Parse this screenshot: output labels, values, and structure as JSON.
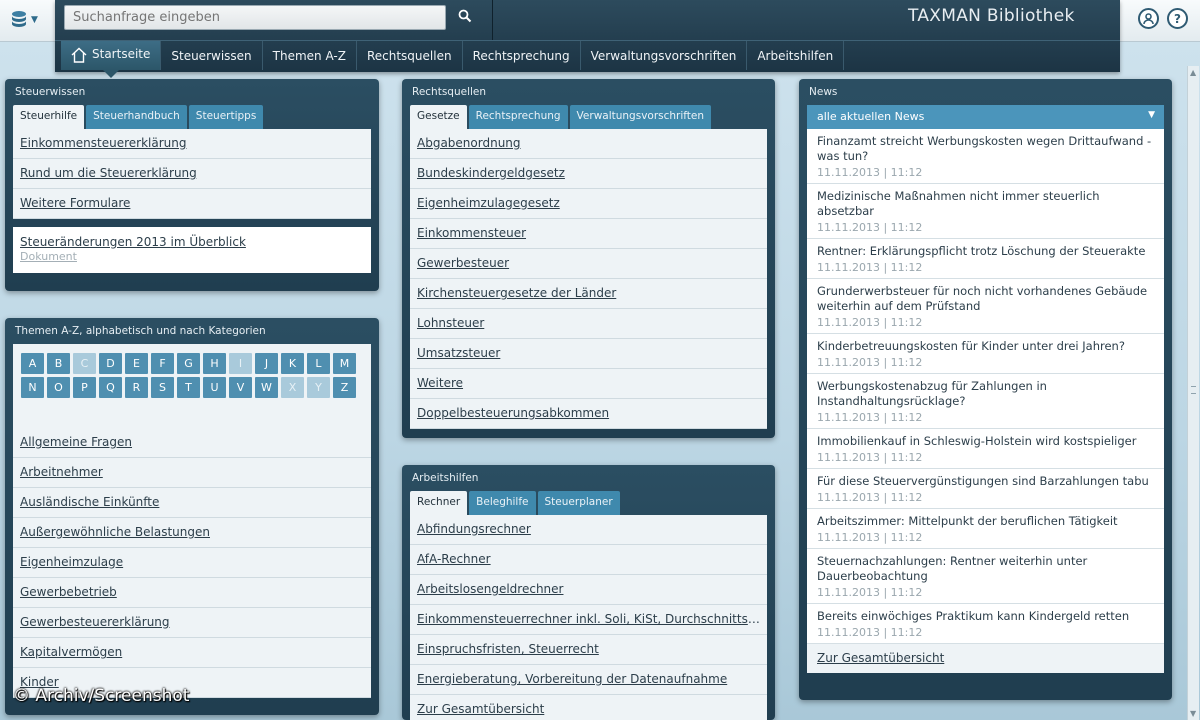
{
  "app": {
    "title": "TAXMAN Bibliothek"
  },
  "search": {
    "placeholder": "Suchanfrage eingeben"
  },
  "nav": {
    "items": [
      "Startseite",
      "Steuerwissen",
      "Themen A-Z",
      "Rechtsquellen",
      "Rechtsprechung",
      "Verwaltungsvorschriften",
      "Arbeitshilfen"
    ]
  },
  "steuerwissen": {
    "title": "Steuerwissen",
    "tabs": [
      "Steuerhilfe",
      "Steuerhandbuch",
      "Steuertipps"
    ],
    "items": [
      "Einkommensteuererklärung",
      "Rund um die Steuererklärung",
      "Weitere Formulare"
    ],
    "doc_title": "Steueränderungen 2013 im Überblick",
    "doc_type": "Dokument"
  },
  "themen": {
    "title": "Themen A-Z, alphabetisch und nach Kategorien",
    "row1": [
      "A",
      "B",
      "C",
      "D",
      "E",
      "F",
      "G",
      "H",
      "I",
      "J",
      "K",
      "L",
      "M"
    ],
    "row2": [
      "N",
      "O",
      "P",
      "Q",
      "R",
      "S",
      "T",
      "U",
      "V",
      "W",
      "X",
      "Y",
      "Z"
    ],
    "disabled": [
      "C",
      "I",
      "X",
      "Y"
    ],
    "items": [
      "Allgemeine Fragen",
      "Arbeitnehmer",
      "Ausländische Einkünfte",
      "Außergewöhnliche Belastungen",
      "Eigenheimzulage",
      "Gewerbebetrieb",
      "Gewerbesteuererklärung",
      "Kapitalvermögen",
      "Kinder"
    ]
  },
  "rechtsquellen": {
    "title": "Rechtsquellen",
    "tabs": [
      "Gesetze",
      "Rechtsprechung",
      "Verwaltungsvorschriften"
    ],
    "items": [
      "Abgabenordnung",
      "Bundeskindergeldgesetz",
      "Eigenheimzulagegesetz",
      "Einkommensteuer",
      "Gewerbesteuer",
      "Kirchensteuergesetze der Länder",
      "Lohnsteuer",
      "Umsatzsteuer",
      "Weitere",
      "Doppelbesteuerungsabkommen"
    ]
  },
  "arbeitshilfen": {
    "title": "Arbeitshilfen",
    "tabs": [
      "Rechner",
      "Beleghilfe",
      "Steuerplaner"
    ],
    "items": [
      "Abfindungsrechner",
      "AfA-Rechner",
      "Arbeitslosengeldrechner",
      "Einkommensteuerrechner inkl. Soli, KiSt, Durchschnitts- u. Grenzsteuersatz",
      "Einspruchsfristen, Steuerrecht",
      "Energieberatung, Vorbereitung der Datenaufnahme",
      "Zur Gesamtübersicht"
    ]
  },
  "news": {
    "title": "News",
    "dropdown": "alle aktuellen News",
    "items": [
      {
        "title": "Finanzamt streicht Werbungskosten wegen Drittaufwand - was tun?",
        "date": "11.11.2013 | 11:12"
      },
      {
        "title": "Medizinische Maßnahmen nicht immer steuerlich absetzbar",
        "date": "11.11.2013 | 11:12"
      },
      {
        "title": "Rentner: Erklärungspflicht trotz Löschung der Steuerakte",
        "date": "11.11.2013 | 11:12"
      },
      {
        "title": "Grunderwerbsteuer für noch nicht vorhandenes Gebäude weiterhin auf dem Prüfstand",
        "date": "11.11.2013 | 11:12"
      },
      {
        "title": "Kinderbetreuungskosten für Kinder unter drei Jahren?",
        "date": "11.11.2013 | 11:12"
      },
      {
        "title": "Werbungskostenabzug für Zahlungen in Instandhaltungsrücklage?",
        "date": "11.11.2013 | 11:12"
      },
      {
        "title": "Immobilienkauf in Schleswig-Holstein wird kostspieliger",
        "date": "11.11.2013 | 11:12"
      },
      {
        "title": "Für diese Steuervergünstigungen sind Barzahlungen tabu",
        "date": "11.11.2013 | 11:12"
      },
      {
        "title": "Arbeitszimmer: Mittelpunkt der beruflichen Tätigkeit",
        "date": "11.11.2013 | 11:12"
      },
      {
        "title": "Steuernachzahlungen: Rentner weiterhin unter Dauerbeobachtung",
        "date": "11.11.2013 | 11:12"
      },
      {
        "title": "Bereits einwöchiges Praktikum kann Kindergeld retten",
        "date": "11.11.2013 | 11:12"
      }
    ],
    "footer": "Zur Gesamtübersicht"
  },
  "watermark": "© Archiv/Screenshot"
}
